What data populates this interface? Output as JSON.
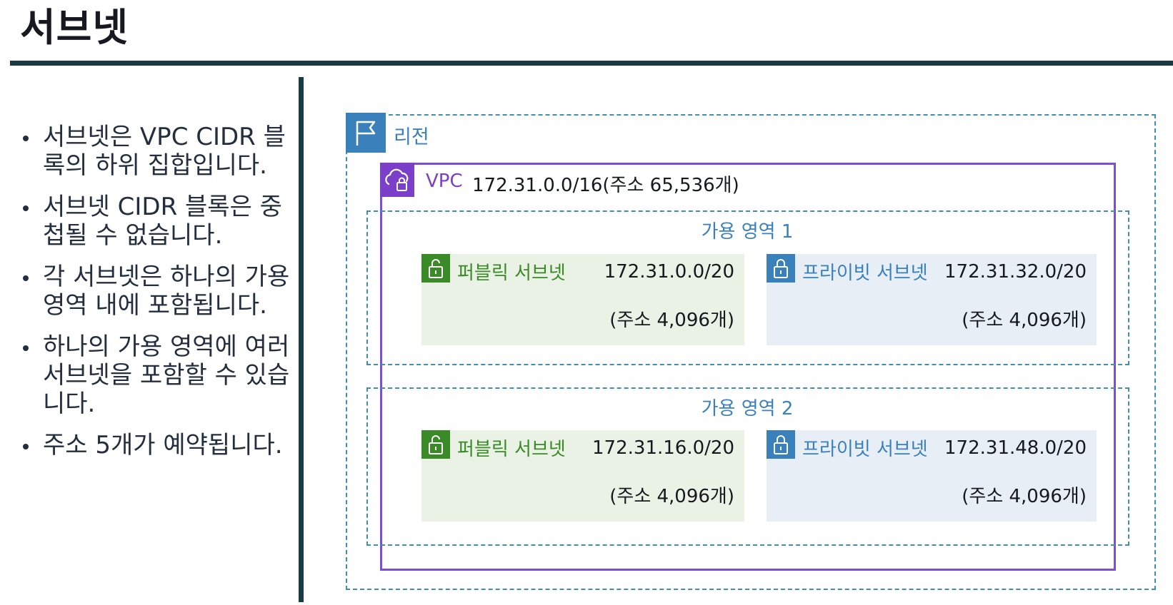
{
  "title": "서브넷",
  "bullets": [
    "서브넷은 VPC CIDR 블록의 하위 집합입니다.",
    "서브넷 CIDR 블록은 중첩될 수 없습니다.",
    "각 서브넷은 하나의 가용 영역 내에 포함됩니다.",
    "하나의 가용 영역에 여러 서브넷을 포함할 수 있습니다.",
    "주소 5개가 예약됩니다."
  ],
  "diagram": {
    "region": {
      "label": "리전",
      "icon": "flag-icon"
    },
    "vpc": {
      "label": "VPC",
      "cidr": "172.31.0.0/16(주소 65,536개)",
      "icon": "cloud-lock-icon"
    },
    "availability_zones": [
      {
        "label": "가용 영역 1",
        "subnets": [
          {
            "name": "퍼블릭 서브넷",
            "cidr": "172.31.0.0/20",
            "addresses": "(주소 4,096개)",
            "icon": "unlock-icon"
          },
          {
            "name": "프라이빗 서브넷",
            "cidr": "172.31.32.0/20",
            "addresses": "(주소 4,096개)",
            "icon": "lock-icon"
          }
        ]
      },
      {
        "label": "가용 영역 2",
        "subnets": [
          {
            "name": "퍼블릭 서브넷",
            "cidr": "172.31.16.0/20",
            "addresses": "(주소 4,096개)",
            "icon": "unlock-icon"
          },
          {
            "name": "프라이빗 서브넷",
            "cidr": "172.31.48.0/20",
            "addresses": "(주소 4,096개)",
            "icon": "lock-icon"
          }
        ]
      }
    ]
  },
  "colors": {
    "heading_rule": "#1b3b44",
    "region": "#3a81bc",
    "vpc": "#7b3fc9",
    "public_subnet": "#3b8a28",
    "public_subnet_bg": "#e9f2e5",
    "private_subnet": "#3a81bc",
    "private_subnet_bg": "#e8eef5"
  }
}
